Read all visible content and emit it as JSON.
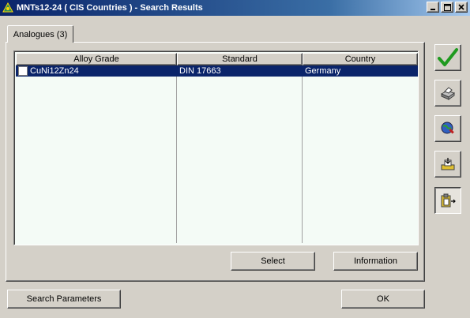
{
  "window": {
    "title": "MNTs12-24 ( CIS Countries ) - Search Results",
    "controls": {
      "minimize": "_",
      "maximize": "□",
      "close": "×"
    }
  },
  "tabs": [
    {
      "label": "Analogues (3)",
      "active": true
    }
  ],
  "table": {
    "columns": [
      "Alloy Grade",
      "Standard",
      "Country"
    ],
    "rows": [
      {
        "alloy_grade": "CuNi12Zn24",
        "standard": "DIN 17663",
        "country": "Germany",
        "selected": true
      }
    ]
  },
  "panel_buttons": {
    "select": "Select",
    "information": "Information"
  },
  "footer_buttons": {
    "search_parameters": "Search Parameters",
    "ok": "OK"
  },
  "side_toolbar": [
    {
      "icon": "checkmark-icon",
      "color": "#1f9a1f"
    },
    {
      "icon": "printer-icon"
    },
    {
      "icon": "globe-search-icon"
    },
    {
      "icon": "export-icon"
    },
    {
      "icon": "clipboard-copy-icon",
      "pressed": true
    }
  ],
  "colors": {
    "face": "#d4d0c8",
    "selection": "#0a246a",
    "grid_bg": "#f4fbf6",
    "title_gradient_start": "#0a246a"
  }
}
